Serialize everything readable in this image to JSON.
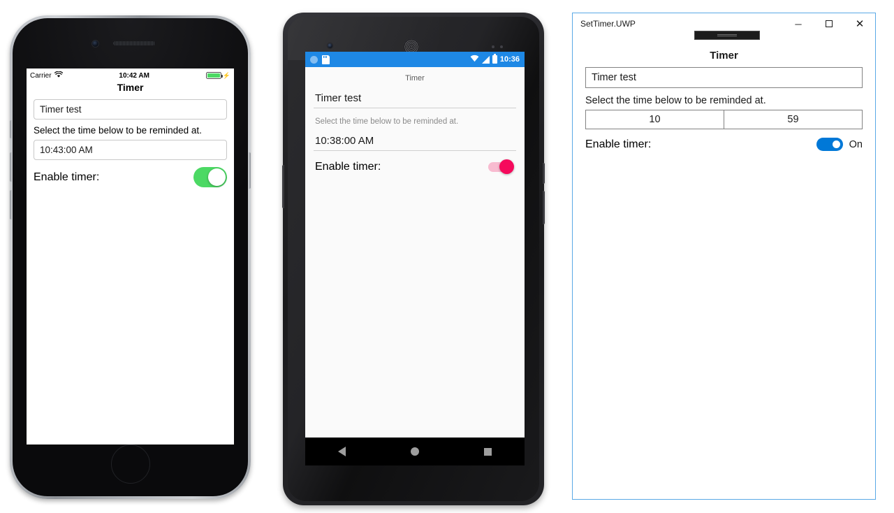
{
  "iphone": {
    "status_bar": {
      "carrier": "Carrier",
      "wifi_icon": "wifi-icon",
      "time": "10:42 AM",
      "battery_icon": "battery-full-icon",
      "charging_icon": "charging-bolt-icon"
    },
    "page_title": "Timer",
    "name_field_value": "Timer test",
    "instruction_label": "Select the time below to be reminded at.",
    "time_field_value": "10:43:00 AM",
    "enable_label": "Enable timer:",
    "toggle_state": "on",
    "toggle_color": "#4cd964",
    "home_button_icon": "home-button-icon",
    "front_camera_icon": "front-camera-icon",
    "earpiece_icon": "earpiece-speaker-icon"
  },
  "android": {
    "status_bar": {
      "notification_icon": "circle-notification-icon",
      "sdcard_icon": "sdcard-icon",
      "wifi_icon": "wifi-icon",
      "signal_icon": "cellular-signal-icon",
      "battery_icon": "battery-icon",
      "time": "10:36"
    },
    "status_bar_color": "#1e88e5",
    "page_title": "Timer",
    "name_field_value": "Timer test",
    "instruction_label": "Select the time below to be reminded at.",
    "time_field_value": "10:38:00 AM",
    "enable_label": "Enable timer:",
    "toggle_state": "on",
    "toggle_color": "#f50a5c",
    "nav_bar": {
      "back_icon": "nav-back-icon",
      "home_icon": "nav-home-icon",
      "recents_icon": "nav-recents-icon"
    },
    "front_camera_icon": "front-camera-icon",
    "earpiece_icon": "earpiece-speaker-icon"
  },
  "uwp": {
    "window_title": "SetTimer.UWP",
    "caption": {
      "minimize": "minimize-button",
      "maximize": "maximize-button",
      "close": "close-button",
      "minimize_glyph": "─",
      "close_glyph": "✕"
    },
    "page_title": "Timer",
    "name_field_value": "Timer test",
    "instruction_label": "Select the time below to be reminded at.",
    "time_hour": "10",
    "time_minute": "59",
    "enable_label": "Enable timer:",
    "toggle_state": "on",
    "toggle_label": "On",
    "toggle_color": "#0078d7",
    "border_color": "#5aa9e6"
  }
}
